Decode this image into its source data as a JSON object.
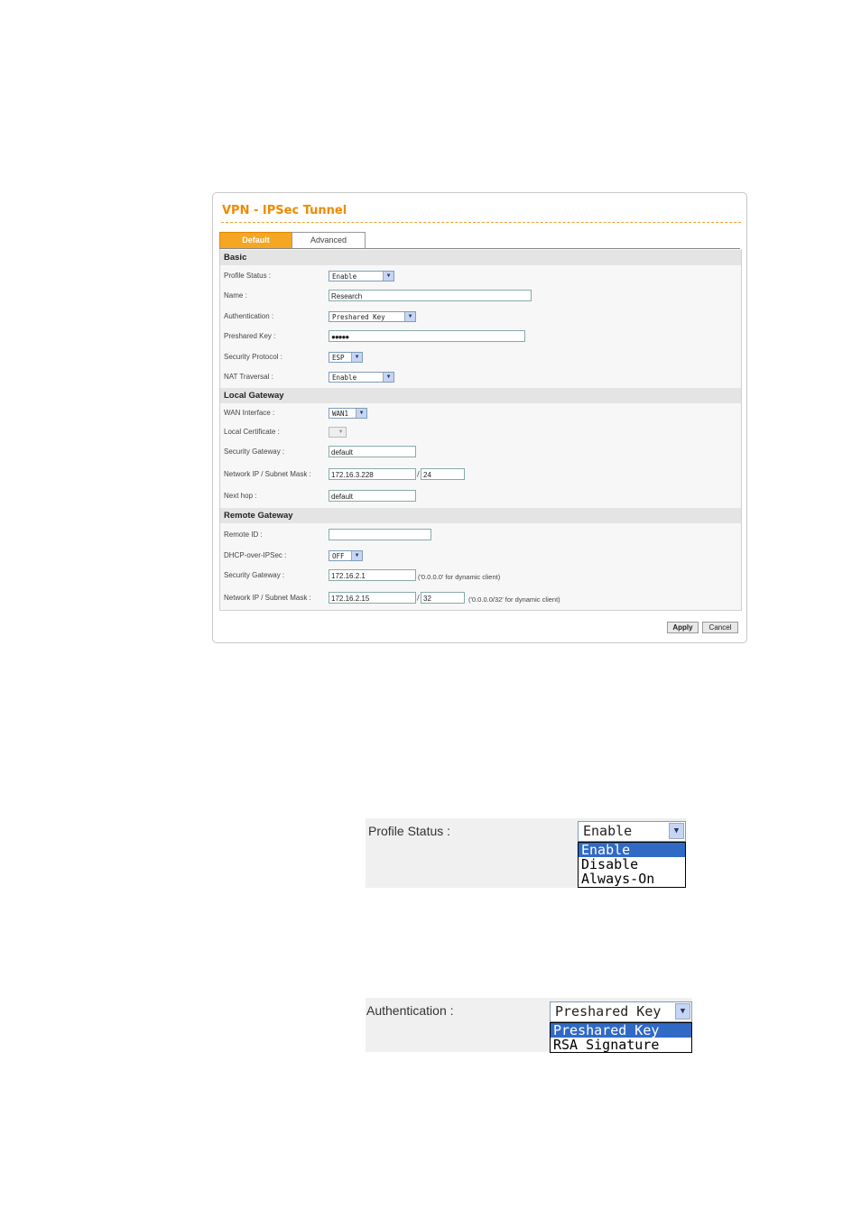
{
  "window": {
    "title": "VPN - IPSec Tunnel"
  },
  "tabs": [
    {
      "label": "Default"
    },
    {
      "label": "Advanced"
    }
  ],
  "sections": {
    "basic": "Basic",
    "local": "Local Gateway",
    "remote": "Remote Gateway"
  },
  "basic": {
    "profile_status_label": "Profile Status :",
    "profile_status_value": "Enable",
    "name_label": "Name :",
    "name_value": "Research",
    "authentication_label": "Authentication :",
    "authentication_value": "Preshared Key",
    "preshared_key_label": "Preshared Key :",
    "preshared_key_value": "●●●●●",
    "security_protocol_label": "Security Protocol :",
    "security_protocol_value": "ESP",
    "nat_traversal_label": "NAT Traversal :",
    "nat_traversal_value": "Enable"
  },
  "local": {
    "wan_interface_label": "WAN Interface :",
    "wan_interface_value": "WAN1",
    "local_certificate_label": "Local Certificate :",
    "security_gateway_label": "Security Gateway :",
    "security_gateway_value": "default",
    "network_label": "Network IP / Subnet Mask :",
    "network_ip": "172.16.3.228",
    "network_mask": "24",
    "next_hop_label": "Next hop :",
    "next_hop_value": "default"
  },
  "remote": {
    "remote_id_label": "Remote ID :",
    "remote_id_value": "",
    "dhcp_over_ipsec_label": "DHCP-over-IPSec :",
    "dhcp_over_ipsec_value": "OFF",
    "security_gateway_label": "Security Gateway :",
    "security_gateway_value": "172.16.2.1",
    "security_gateway_note": "('0.0.0.0' for dynamic client)",
    "network_label": "Network IP / Subnet Mask :",
    "network_ip": "172.16.2.15",
    "network_mask": "32",
    "network_note": "('0.0.0.0/32' for dynamic client)"
  },
  "slash": "/",
  "buttons": {
    "apply": "Apply",
    "cancel": "Cancel"
  },
  "zoom_profile": {
    "label": "Profile Status :",
    "selected": "Enable",
    "options": [
      "Enable",
      "Disable",
      "Always-On"
    ]
  },
  "zoom_auth": {
    "label": "Authentication :",
    "selected": "Preshared Key",
    "options": [
      "Preshared Key",
      "RSA Signature"
    ]
  },
  "colors": {
    "accent": "#f08a00",
    "tab_active": "#f5a623",
    "highlight": "#316ac5"
  }
}
